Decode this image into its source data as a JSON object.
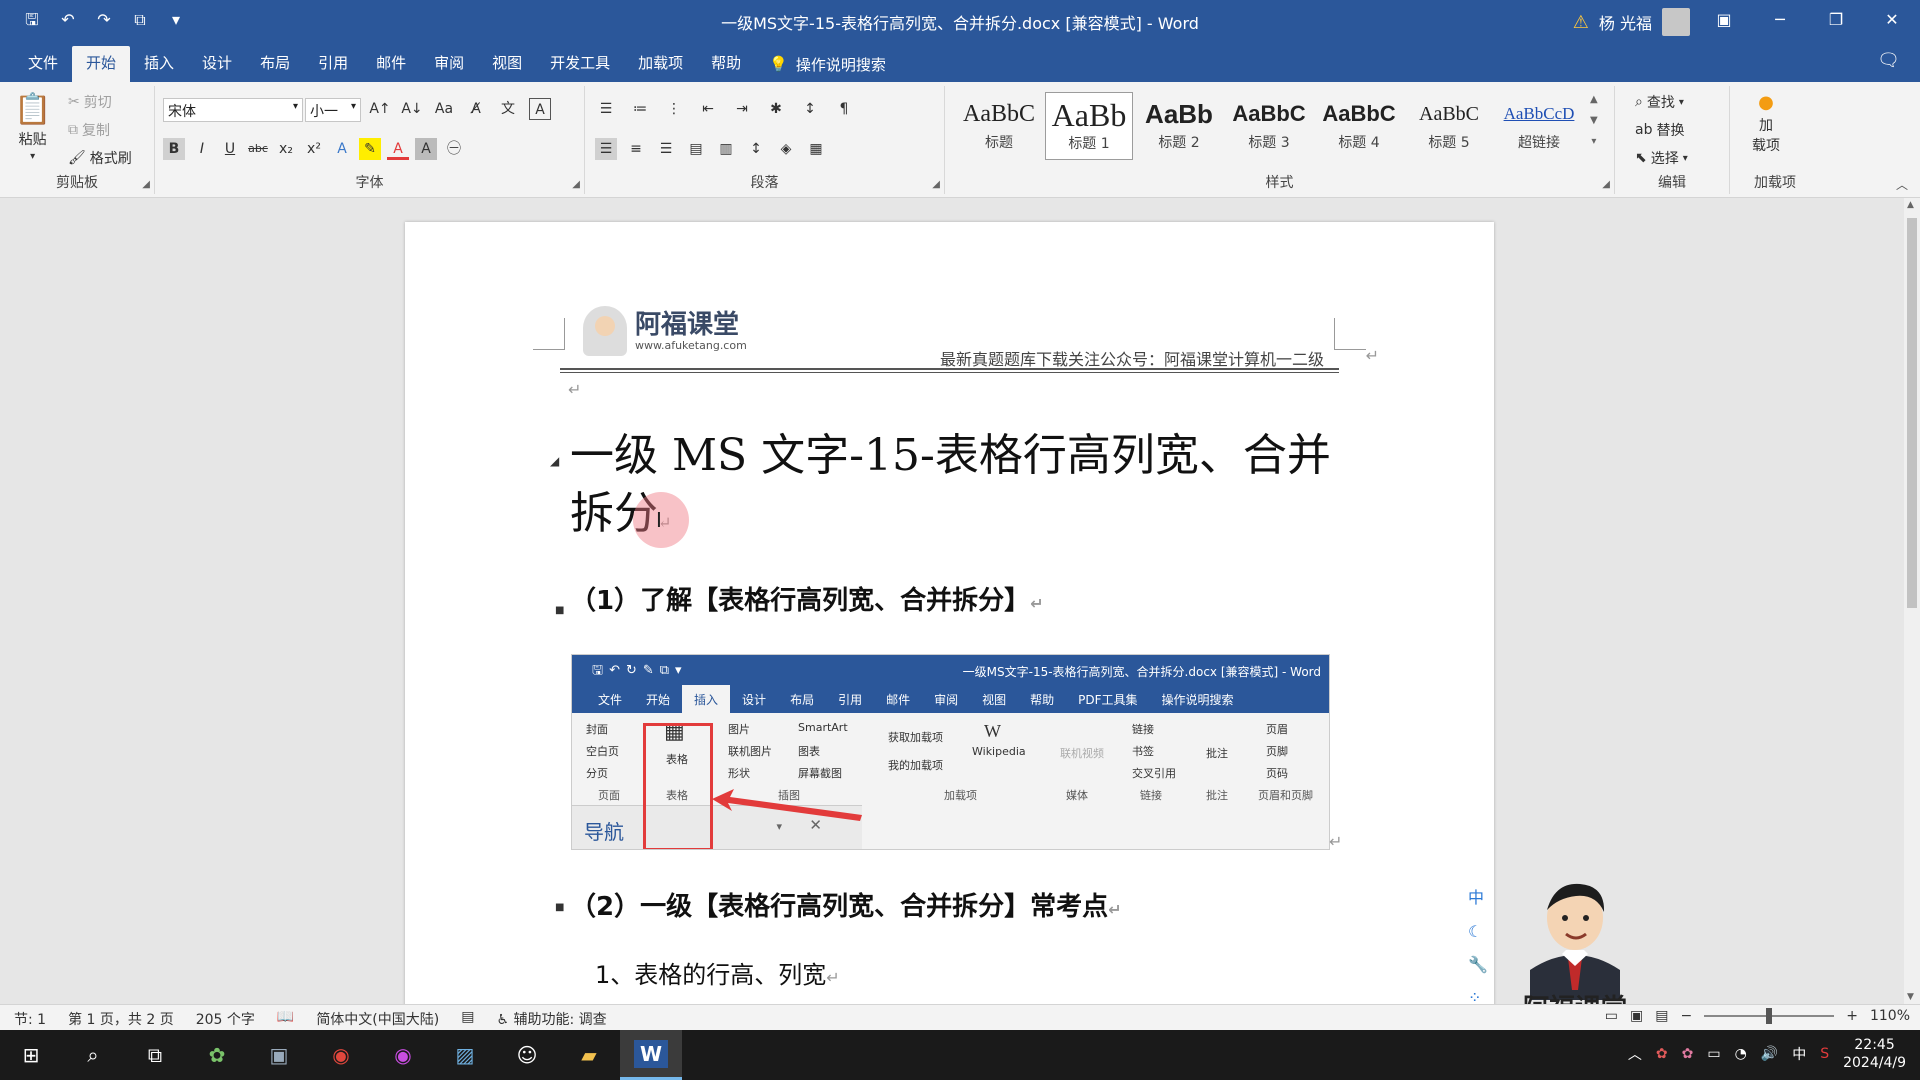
{
  "titlebar": {
    "doc_title": "一级MS文字-15-表格行高列宽、合并拆分.docx [兼容模式] - Word",
    "user_name": "杨 光福"
  },
  "tabs": [
    "文件",
    "开始",
    "插入",
    "设计",
    "布局",
    "引用",
    "邮件",
    "审阅",
    "视图",
    "开发工具",
    "加载项",
    "帮助"
  ],
  "tell_me": "操作说明搜索",
  "ribbon": {
    "clipboard": {
      "paste": "粘贴",
      "cut": "剪切",
      "copy": "复制",
      "format_painter": "格式刷",
      "label": "剪贴板"
    },
    "font": {
      "font_name": "宋体",
      "font_size": "小一",
      "label": "字体"
    },
    "paragraph": {
      "label": "段落"
    },
    "styles": {
      "items": [
        {
          "preview": "AaBbC",
          "name": "标题"
        },
        {
          "preview": "AaBb",
          "name": "标题 1"
        },
        {
          "preview": "AaBb",
          "name": "标题 2"
        },
        {
          "preview": "AaBbC",
          "name": "标题 3"
        },
        {
          "preview": "AaBbC",
          "name": "标题 4"
        },
        {
          "preview": "AaBbC",
          "name": "标题 5"
        },
        {
          "preview": "AaBbCcD",
          "name": "超链接"
        }
      ],
      "label": "样式"
    },
    "editing": {
      "find": "查找",
      "replace": "替换",
      "select": "选择",
      "label": "编辑"
    },
    "addins": {
      "button": "加\n载项",
      "label": "加载项"
    }
  },
  "document": {
    "header_logo_text": "阿福课堂",
    "header_logo_url": "www.afuketang.com",
    "header_text": "最新真题题库下载关注公众号：阿福课堂计算机一二级",
    "title": "一级 MS 文字-15-表格行高列宽、合并拆分",
    "h2_1": "（1）了解【表格行高列宽、合并拆分】",
    "h2_2": "（2）一级【表格行高列宽、合并拆分】常考点",
    "h3_1": "1、表格的行高、列宽"
  },
  "embed": {
    "title": "一级MS文字-15-表格行高列宽、合并拆分.docx [兼容模式] - Word",
    "tabs": [
      "文件",
      "开始",
      "插入",
      "设计",
      "布局",
      "引用",
      "邮件",
      "审阅",
      "视图",
      "帮助",
      "PDF工具集",
      "操作说明搜索"
    ],
    "pages": {
      "cover": "封面",
      "blank": "空白页",
      "break": "分页",
      "label": "页面"
    },
    "tables": {
      "button": "表格",
      "label": "表格"
    },
    "illus": {
      "picture": "图片",
      "online_picture": "联机图片",
      "shapes": "形状",
      "smartart": "SmartArt",
      "chart": "图表",
      "screenshot": "屏幕截图",
      "label": "插图"
    },
    "addins": {
      "get": "获取加载项",
      "my": "我的加载项",
      "wiki": "Wikipedia",
      "label": "加载项"
    },
    "media": {
      "online_video": "联机视频",
      "label": "媒体"
    },
    "links": {
      "link": "链接",
      "bookmark": "书签",
      "crossref": "交叉引用",
      "label": "链接"
    },
    "comments": {
      "comment": "批注",
      "label": "批注"
    },
    "hf": {
      "header": "页眉",
      "footer": "页脚",
      "page_number": "页码",
      "label": "页眉和页脚"
    },
    "nav": "导航"
  },
  "float": {
    "ime": "中",
    "mascot_text": "阿福课堂"
  },
  "status": {
    "section": "节: 1",
    "page": "第 1 页，共 2 页",
    "words": "205 个字",
    "lang": "简体中文(中国大陆)",
    "accessibility": "辅助功能: 调查",
    "zoom": "110%"
  },
  "taskbar": {
    "ime": "中",
    "time": "22:45",
    "date": "2024/4/9"
  },
  "colors": {
    "word_blue": "#2b579a",
    "annotation_red": "#e23b3b"
  }
}
